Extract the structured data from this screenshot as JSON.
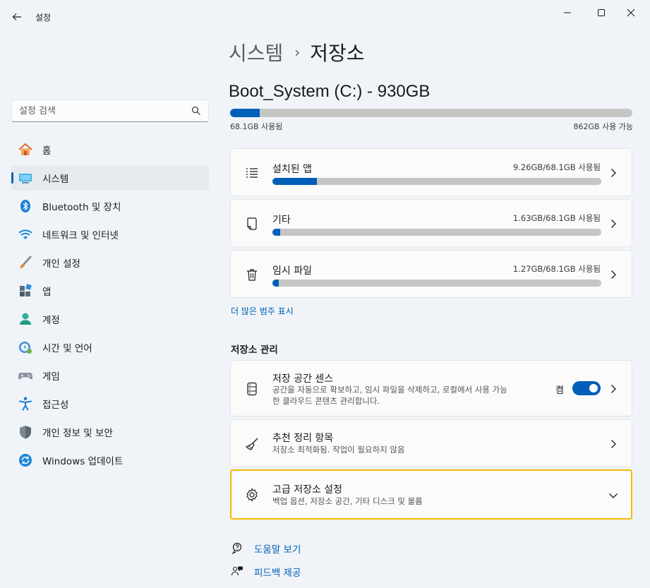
{
  "window": {
    "title": "설정",
    "controls": [
      "minimize-icon",
      "maximize-icon",
      "close-icon"
    ]
  },
  "search": {
    "placeholder": "설정 검색"
  },
  "sidebar": {
    "items": [
      {
        "label": "홈",
        "icon": "home-icon"
      },
      {
        "label": "시스템",
        "icon": "system-icon",
        "active": true
      },
      {
        "label": "Bluetooth 및 장치",
        "icon": "bluetooth-icon"
      },
      {
        "label": "네트워크 및 인터넷",
        "icon": "wifi-icon"
      },
      {
        "label": "개인 설정",
        "icon": "brush-icon"
      },
      {
        "label": "앱",
        "icon": "apps-icon"
      },
      {
        "label": "계정",
        "icon": "account-icon"
      },
      {
        "label": "시간 및 언어",
        "icon": "time-language-icon"
      },
      {
        "label": "게임",
        "icon": "gaming-icon"
      },
      {
        "label": "접근성",
        "icon": "accessibility-icon"
      },
      {
        "label": "개인 정보 및 보안",
        "icon": "shield-icon"
      },
      {
        "label": "Windows 업데이트",
        "icon": "update-icon"
      }
    ]
  },
  "breadcrumb": {
    "parent": "시스템",
    "separator": "›",
    "current": "저장소"
  },
  "drive": {
    "title": "Boot_System (C:) - 930GB",
    "used_label": "68.1GB 사용됨",
    "free_label": "862GB 사용 가능",
    "used_fraction": 0.073
  },
  "categories": [
    {
      "title": "설치된 앱",
      "size": "9.26GB/68.1GB 사용됨",
      "fraction": 0.136,
      "icon": "list-icon"
    },
    {
      "title": "기타",
      "size": "1.63GB/68.1GB 사용됨",
      "fraction": 0.024,
      "icon": "document-icon"
    },
    {
      "title": "임시 파일",
      "size": "1.27GB/68.1GB 사용됨",
      "fraction": 0.019,
      "icon": "trash-icon"
    }
  ],
  "more_link": "더 많은 범주 표시",
  "management": {
    "section_title": "저장소 관리",
    "storage_sense": {
      "title": "저장 공간 센스",
      "desc_line1": "공간을 자동으로 확보하고, 임시 파일을 삭제하고, 로컬에서 사용 가능",
      "desc_line2": "한 클라우드 콘텐츠 관리합니다.",
      "toggle_label": "켬",
      "toggle_on": true,
      "icon": "drive-icon"
    },
    "cleanup": {
      "title": "추천 정리 항목",
      "desc": "저장소 최적화됨. 작업이 필요하지 않음",
      "icon": "broom-icon"
    },
    "advanced": {
      "title": "고급 저장소 설정",
      "desc": "백업 옵션, 저장소 공간, 기타 디스크 및 볼륨",
      "icon": "gear-icon",
      "highlight_color": "#f5b800"
    }
  },
  "help": [
    {
      "label": "도움말 보기",
      "icon": "help-icon"
    },
    {
      "label": "피드백 제공",
      "icon": "feedback-icon"
    }
  ],
  "colors": {
    "accent": "#005fb8",
    "background": "#f0f4f9",
    "bar_track": "#c5c5c5"
  }
}
